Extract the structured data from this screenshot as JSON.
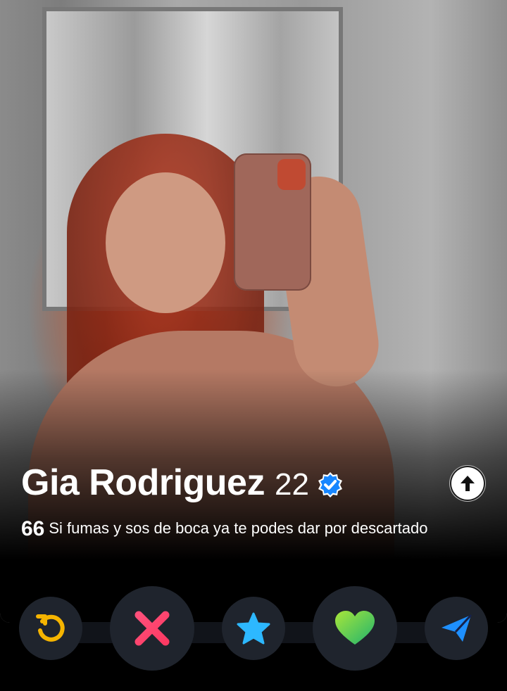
{
  "profile": {
    "name": "Gia Rodriguez",
    "age": "22",
    "verified": true,
    "bio_quote_icon": "66",
    "bio": "Si fumas y sos de boca ya te podes dar por descartado"
  },
  "actions": {
    "rewind": "rewind-icon",
    "nope": "x-icon",
    "super_like": "star-icon",
    "like": "heart-icon",
    "boost": "send-icon"
  },
  "colors": {
    "rewind": "#f5b400",
    "nope": "#fe3c72",
    "super_like": "#2db8ff",
    "like_start": "#7ae053",
    "like_end": "#22b86b",
    "boost": "#1e90ff",
    "verified": "#1786ff"
  }
}
